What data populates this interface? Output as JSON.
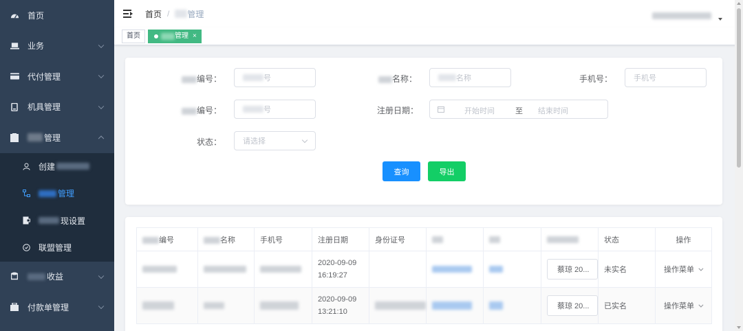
{
  "sidebar": {
    "items": [
      {
        "label": "首页",
        "icon": "dashboard-icon",
        "has_children": false
      },
      {
        "label": "业务",
        "icon": "laptop-icon",
        "has_children": true
      },
      {
        "label": "代付管理",
        "icon": "card-icon",
        "has_children": true
      },
      {
        "label": "机具管理",
        "icon": "device-icon",
        "has_children": true
      },
      {
        "label": "管理",
        "icon": "folder-icon",
        "has_children": true,
        "expanded": true
      },
      {
        "label": "收益",
        "icon": "coins-icon",
        "has_children": true
      },
      {
        "label": "付款单管理",
        "icon": "receipt-icon",
        "has_children": true
      }
    ],
    "submenu": [
      {
        "label": "创建",
        "icon": "user-icon",
        "active": false
      },
      {
        "label": "管理",
        "icon": "tree-icon",
        "active": true
      },
      {
        "label": "现设置",
        "icon": "withdraw-icon",
        "active": false
      },
      {
        "label": "联盟管理",
        "icon": "shield-icon",
        "active": false
      }
    ]
  },
  "header": {
    "breadcrumb": [
      "首页",
      "管理"
    ]
  },
  "tags": {
    "items": [
      {
        "label": "首页",
        "active": false
      },
      {
        "label": "管理",
        "active": true,
        "close": "×"
      }
    ]
  },
  "filter": {
    "row1": {
      "label1": "编号：",
      "placeholder1": "号",
      "label2": "名称：",
      "placeholder2": "名称",
      "label3": "手机号：",
      "placeholder3": "手机号"
    },
    "row2": {
      "label1": "编号：",
      "placeholder1": "号",
      "date_label": "注册日期：",
      "date_start": "开始时间",
      "date_sep": "至",
      "date_end": "结束时间"
    },
    "row3": {
      "status_label": "状态：",
      "status_placeholder": "请选择"
    },
    "query_button": "查询",
    "export_button": "导出"
  },
  "table": {
    "columns": [
      "编号",
      "名称",
      "手机号",
      "注册日期",
      "身份证号",
      "",
      "",
      "",
      "状态",
      "操作"
    ],
    "rows": [
      {
        "date": "2020-09-09",
        "time": "16:19:27",
        "btn": "蔡琼 20...",
        "status": "未实名",
        "op": "操作菜单"
      },
      {
        "date": "2020-09-09",
        "time": "13:21:10",
        "btn": "蔡琼 20...",
        "status": "已实名",
        "op": "操作菜单"
      }
    ]
  },
  "colors": {
    "sidebar_bg": "#304156",
    "submenu_bg": "#1f2d3d",
    "active_blue": "#409eff",
    "tag_active": "#42b983",
    "primary": "#1890ff",
    "success": "#13ce66"
  }
}
